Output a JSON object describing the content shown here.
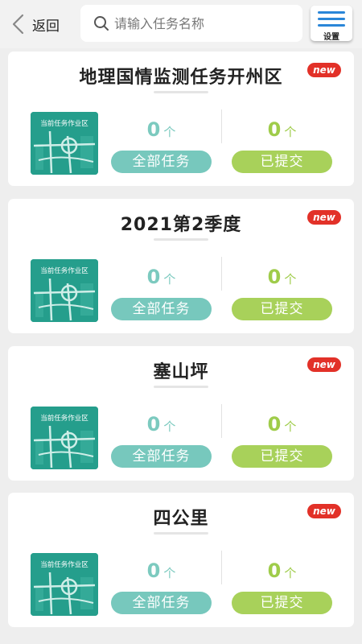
{
  "header": {
    "back_label": "返回",
    "search_placeholder": "请输入任务名称",
    "search_value": "",
    "settings_label": "设置"
  },
  "colors": {
    "accent_blue": "#2a86d8",
    "badge_red": "#e23128",
    "teal": "#77c8bd",
    "green": "#a8d15a",
    "thumb_teal": "#259e8c"
  },
  "cards": [
    {
      "title": "地理国情监测任务开州区",
      "badge": "new",
      "thumb_label": "当前任务作业区",
      "all_count": "0",
      "all_unit": "个",
      "all_label": "全部任务",
      "sub_count": "0",
      "sub_unit": "个",
      "sub_label": "已提交"
    },
    {
      "title": "2021第2季度",
      "badge": "new",
      "thumb_label": "当前任务作业区",
      "all_count": "0",
      "all_unit": "个",
      "all_label": "全部任务",
      "sub_count": "0",
      "sub_unit": "个",
      "sub_label": "已提交"
    },
    {
      "title": "塞山坪",
      "badge": "new",
      "thumb_label": "当前任务作业区",
      "all_count": "0",
      "all_unit": "个",
      "all_label": "全部任务",
      "sub_count": "0",
      "sub_unit": "个",
      "sub_label": "已提交"
    },
    {
      "title": "四公里",
      "badge": "new",
      "thumb_label": "当前任务作业区",
      "all_count": "0",
      "all_unit": "个",
      "all_label": "全部任务",
      "sub_count": "0",
      "sub_unit": "个",
      "sub_label": "已提交"
    }
  ]
}
